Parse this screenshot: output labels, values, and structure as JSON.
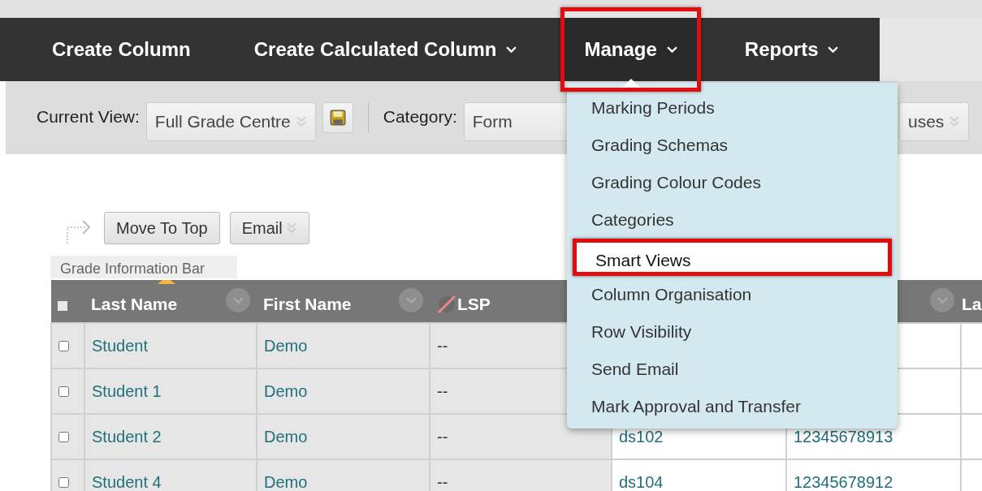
{
  "nav": {
    "items": [
      {
        "label": "Create Column",
        "has_dropdown": false,
        "expanded": false,
        "highlighted": false
      },
      {
        "label": "Create Calculated Column",
        "has_dropdown": true,
        "expanded": false,
        "highlighted": false
      },
      {
        "label": "Manage",
        "has_dropdown": true,
        "expanded": true,
        "highlighted": true
      },
      {
        "label": "Reports",
        "has_dropdown": true,
        "expanded": false,
        "highlighted": false
      }
    ]
  },
  "manage_menu": {
    "items": [
      {
        "label": "Marking Periods",
        "selected": false,
        "highlighted": false
      },
      {
        "label": "Grading Schemas",
        "selected": false,
        "highlighted": false
      },
      {
        "label": "Grading Colour Codes",
        "selected": false,
        "highlighted": false
      },
      {
        "label": "Categories",
        "selected": false,
        "highlighted": false
      },
      {
        "label": "Smart Views",
        "selected": true,
        "highlighted": true
      },
      {
        "label": "Column Organisation",
        "selected": false,
        "highlighted": false
      },
      {
        "label": "Row Visibility",
        "selected": false,
        "highlighted": false
      },
      {
        "label": "Send Email",
        "selected": false,
        "highlighted": false
      },
      {
        "label": "Mark Approval and Transfer",
        "selected": false,
        "highlighted": false
      }
    ]
  },
  "toolbar": {
    "current_view_label": "Current View:",
    "current_view": "Full Grade Centre",
    "category_label": "Category:",
    "category": "Form",
    "status_filter": "uses"
  },
  "actions": [
    {
      "label": "Move To Top",
      "has_dropdown": false
    },
    {
      "label": "Email",
      "has_dropdown": true
    }
  ],
  "info_bar_tab": "Grade Information Bar",
  "table": {
    "columns": [
      {
        "label": "Last Name",
        "sorted": true,
        "hidden_from_students": false
      },
      {
        "label": "First Name",
        "sorted": false,
        "hidden_from_students": false
      },
      {
        "label": "LSP",
        "sorted": false,
        "hidden_from_students": true
      },
      {
        "label": "La",
        "sorted": false,
        "hidden_from_students": false
      }
    ],
    "rows": [
      {
        "checked": false,
        "last_name": "Student",
        "first_name": "Demo",
        "lsp": "--"
      },
      {
        "checked": false,
        "last_name": "Student 1",
        "first_name": "Demo",
        "lsp": "--"
      },
      {
        "checked": false,
        "last_name": "Student 2",
        "first_name": "Demo",
        "lsp": "--",
        "username": "ds102",
        "student_id": "12345678913"
      },
      {
        "checked": false,
        "last_name": "Student 4",
        "first_name": "Demo",
        "lsp": "--",
        "username": "ds104",
        "student_id": "12345678912"
      }
    ]
  }
}
